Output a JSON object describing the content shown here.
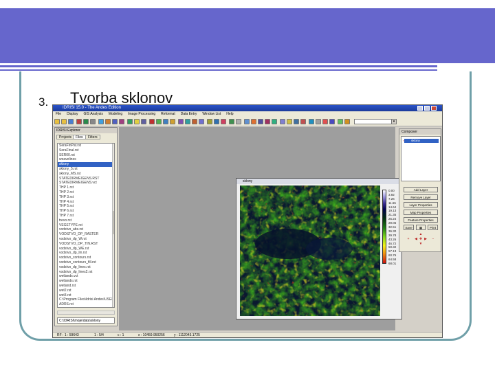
{
  "slide": {
    "bullet_number": "3.",
    "bullet_text": "Tvorba sklonov"
  },
  "app": {
    "title": "IDRISI 15.0 - The Andes Edition",
    "menu": [
      "File",
      "Display",
      "GIS Analysis",
      "Modeling",
      "Image Processing",
      "Reformat",
      "Data Entry",
      "Window List",
      "Help"
    ],
    "explorer": {
      "title": "IDRISI Explorer",
      "tabs": [
        "Projects",
        "Files",
        "Filters"
      ],
      "files": [
        "SeraFinPat.rst",
        "SeraFinal.rst",
        "SER00.rst",
        "weavelines",
        "sklony",
        "sklony_5.rst",
        "sklony_MS.rst",
        "STATEDIRMEIGENS.RST",
        "STATEDIRMEIGENS.vct",
        "THP 1.rst",
        "THP 2.rst",
        "THP 3.rst",
        "THP 4.rst",
        "THP 5.rst",
        "THP 6.rst",
        "THP 7.rst",
        "trevo.rst",
        "VEGETYPE.rst",
        "vodstvo_abs.rst",
        "VODSTVO_DP_RASTER",
        "vodstvo_dp_W.rst",
        "VODSTVO_DP_TIN.RST",
        "vodstvo_dp_WE.rst",
        "vodstvo_dp_lin.rst",
        "vodstvo_contours.rst",
        "vodstvo_contours_fill.rst",
        "vodstvo_dp_lines.rst",
        "vodstvo_dp_lines2.rst",
        "wetlands.vct",
        "wetlands.rst",
        "wetland.rst",
        "wet2.rst",
        "wet3.rst",
        "C:\\Program Files\\Idrisi Andes\\USER",
        "ADRS.rst"
      ],
      "selected_index": 4,
      "path": "C:\\IDRISI\\moje\\data\\sklony"
    },
    "map_window": {
      "title": "sklony",
      "legend": [
        "0.00",
        "3.92",
        "7.26",
        "11.65",
        "14.64",
        "19.13",
        "21.35",
        "25.24",
        "29.06",
        "32.51",
        "36.30",
        "39.78",
        "43.26",
        "46.72",
        "50.32",
        "57.13",
        "60.76",
        "64.58",
        "68.01"
      ]
    },
    "composer": {
      "title": "Composer",
      "layer": "sklony",
      "buttons": [
        "Add Layer",
        "Remove Layer",
        "Layer Properties",
        "Map Properties",
        "Feature Properties"
      ],
      "save": "Save",
      "print": "Print"
    },
    "status": {
      "rf": "RF : 1 : 59643",
      "scale": "1 : 5/4",
      "col": "c : 1",
      "x": "x : 10459.950256",
      "y": "y : 1112043.1725"
    }
  }
}
